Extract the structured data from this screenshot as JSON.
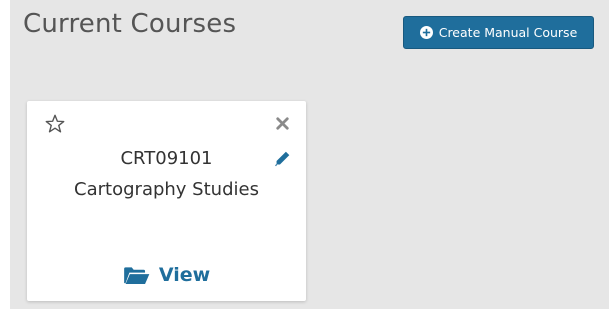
{
  "header": {
    "title": "Current Courses",
    "create_button_label": "Create Manual Course"
  },
  "course_card": {
    "code": "CRT09101",
    "name": "Cartography Studies",
    "view_label": "View"
  },
  "colors": {
    "accent": "#1f6e9c",
    "panel_background": "#e6e6e6"
  },
  "icons": {
    "create": "plus-circle-icon",
    "favorite": "star-outline-icon",
    "remove": "close-icon",
    "edit": "pencil-icon",
    "view": "folder-open-icon"
  }
}
